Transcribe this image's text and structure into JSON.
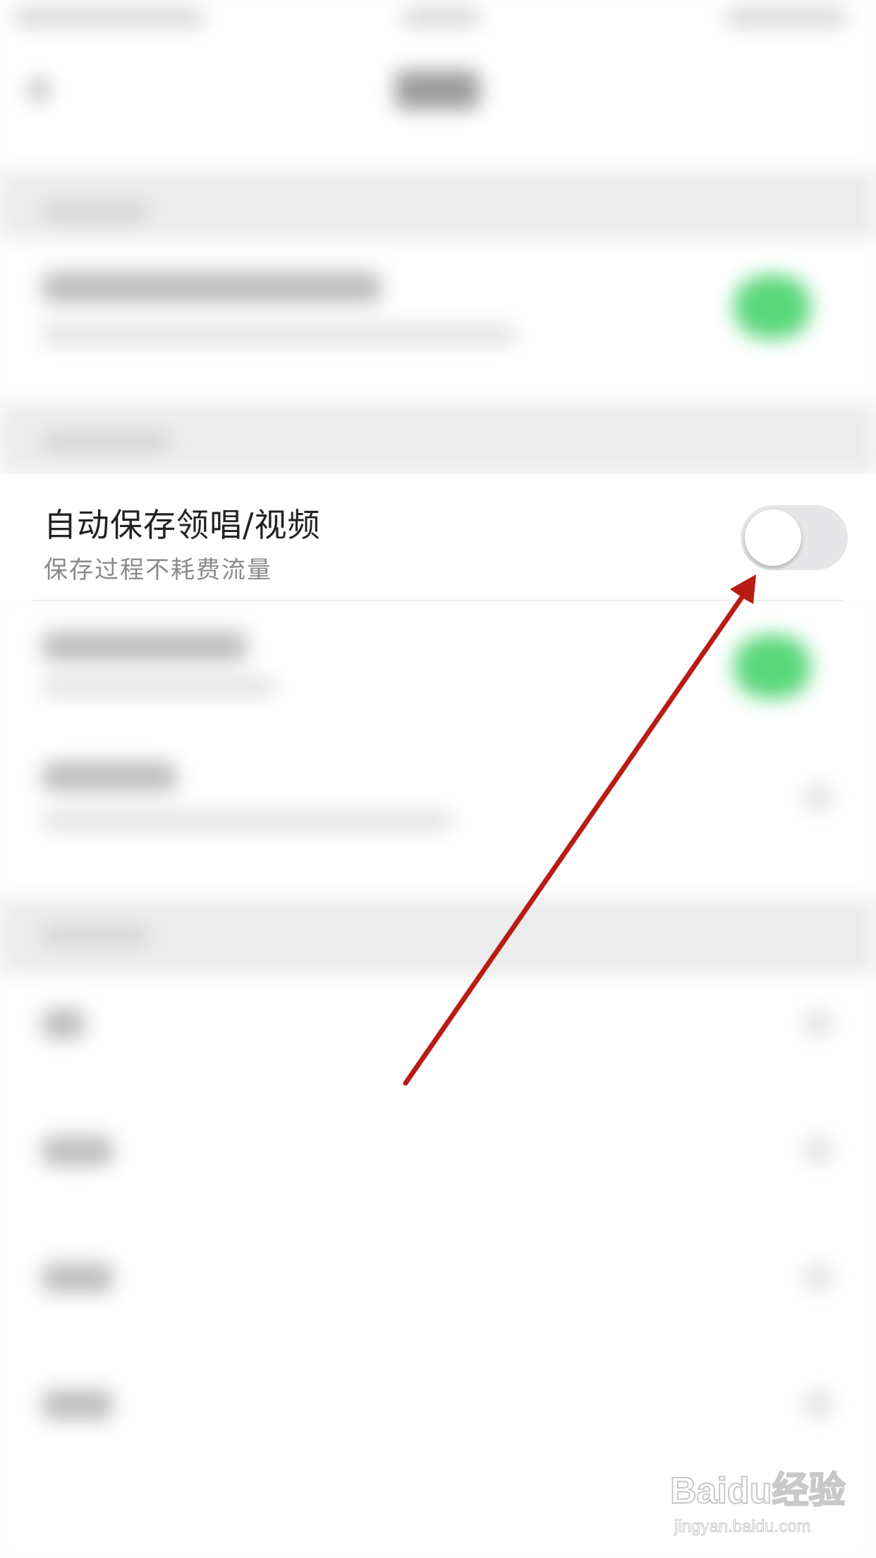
{
  "setting": {
    "title": "自动保存领唱/视频",
    "subtitle": "保存过程不耗费流量",
    "toggle_state": "off"
  },
  "annotation": {
    "type": "arrow",
    "color": "#b81c14",
    "points_to": "auto-save-toggle"
  },
  "watermark": {
    "logo": "Baidu经验",
    "url": "jingyan.baidu.com"
  },
  "colors": {
    "toggle_off_track": "#e6e6e8",
    "toggle_on_track": "#59d77a",
    "arrow": "#b81c14"
  }
}
